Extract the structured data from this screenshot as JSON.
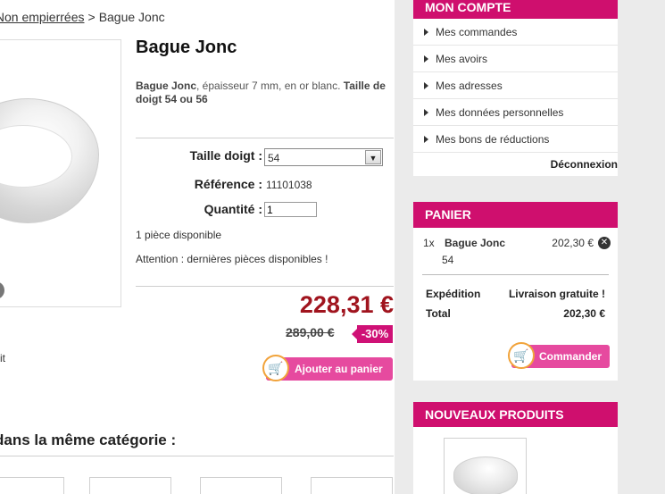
{
  "breadcrumb": {
    "parent": "s Non empierrées",
    "separator": ">",
    "current": "Bague Jonc"
  },
  "product": {
    "title": "Bague Jonc",
    "description_name": "Bague Jonc",
    "description_text": ", épaisseur 7 mm, en or blanc. ",
    "description_sizes": "Taille de doigt 54 ou 56",
    "size_label": "Taille doigt :",
    "size_value": "54",
    "reference_label": "Référence :",
    "reference_value": "11101038",
    "quantity_label": "Quantité :",
    "quantity_value": "1",
    "availability": "1 pièce disponible",
    "warning": "Attention : dernières pièces disponibles !",
    "price": "228,31 €",
    "old_price": "289,00 €",
    "discount": "-30%",
    "add_to_cart_label": "Ajouter au panier",
    "stray_text": "it"
  },
  "related": {
    "title": "dans la même catégorie :"
  },
  "account": {
    "title": "MON COMPTE",
    "items": [
      {
        "label": "Mes commandes"
      },
      {
        "label": "Mes avoirs"
      },
      {
        "label": "Mes adresses"
      },
      {
        "label": "Mes données personnelles"
      },
      {
        "label": "Mes bons de réductions"
      }
    ],
    "logout": "Déconnexion"
  },
  "cart": {
    "title": "PANIER",
    "line": {
      "qty": "1x",
      "name": "Bague Jonc",
      "price": "202,30 €",
      "attribute": "54"
    },
    "shipping_label": "Expédition",
    "shipping_value": "Livraison gratuite !",
    "total_label": "Total",
    "total_value": "202,30 €",
    "order_label": "Commander"
  },
  "new_products": {
    "title": "NOUVEAUX PRODUITS"
  },
  "colors": {
    "brand": "#cf0f6e",
    "price": "#a0141e",
    "button": "#e64a9f",
    "sidebar_bg": "#ebebeb"
  },
  "icons": {
    "cart": "cart-icon",
    "remove": "remove-icon",
    "bullet": "triangle-right-icon",
    "dropdown": "chevron-down-icon"
  }
}
